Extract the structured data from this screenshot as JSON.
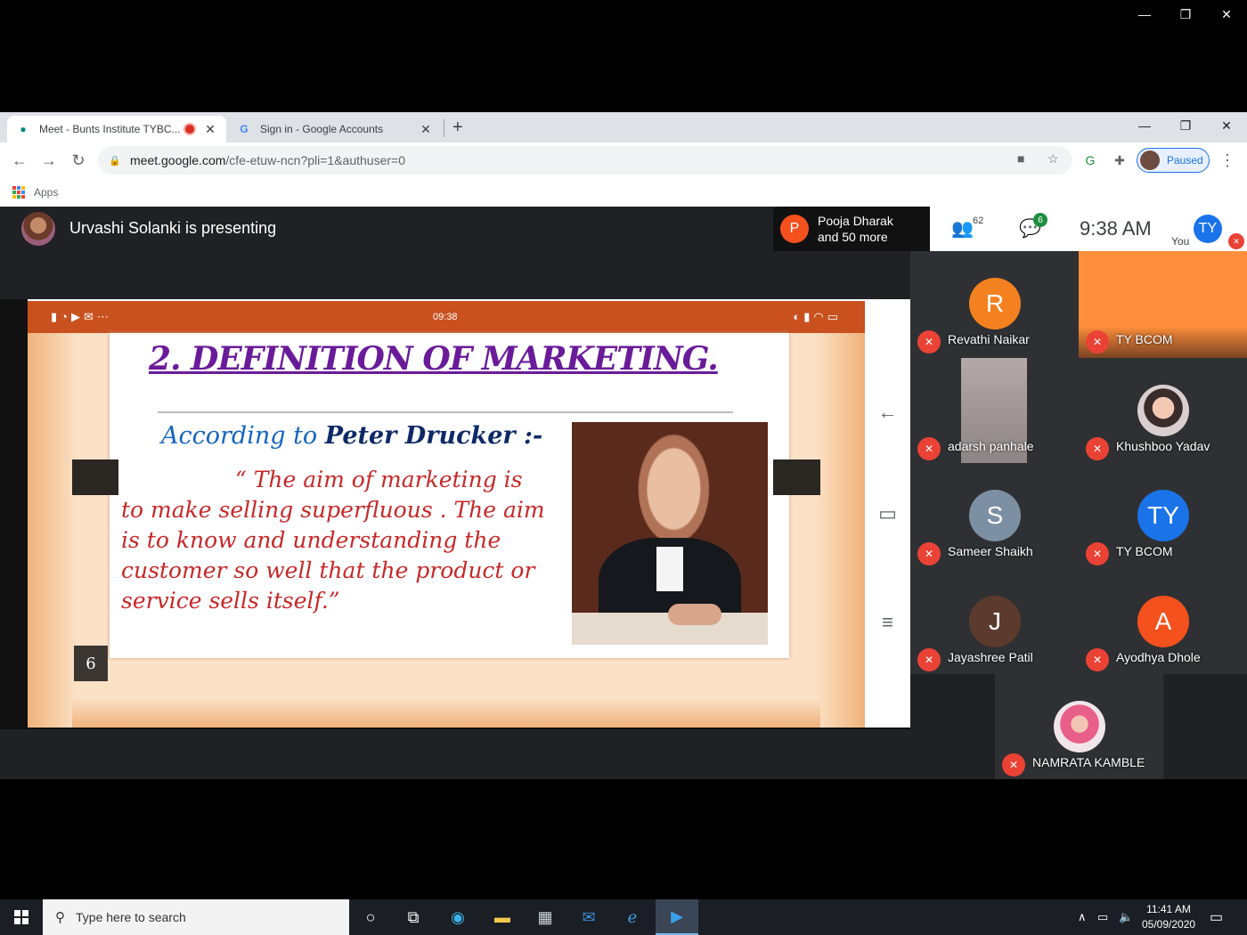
{
  "browser": {
    "tabs": [
      {
        "title": "Meet - Bunts Institute TYBC...",
        "active": true
      },
      {
        "title": "Sign in - Google Accounts",
        "active": false
      }
    ],
    "new_tab_icon": "+",
    "url_host": "meet.google.com",
    "url_path": "/cfe-etuw-ncn?pli=1&authuser=0",
    "profile_status": "Paused",
    "bookmarks": {
      "apps_label": "Apps"
    }
  },
  "meet": {
    "presenting_text": "Urvashi Solanki is presenting",
    "join_notice": {
      "initial": "P",
      "line1": "Pooja Dharak",
      "line2": "and 50 more"
    },
    "participant_count": "62",
    "chat_badge": "6",
    "time": "9:38  AM",
    "self": {
      "label": "You",
      "initials": "TY"
    },
    "participants": [
      {
        "name": "Revathi Naikar",
        "initial": "R",
        "color": "#f4811f",
        "muted": true
      },
      {
        "name": "TY BCOM",
        "initial": "",
        "color": "#ff8f3c",
        "muted": true
      },
      {
        "name": "adarsh panhale",
        "initial": "",
        "color": "",
        "muted": true
      },
      {
        "name": "Khushboo Yadav",
        "initial": "",
        "color": "",
        "muted": true
      },
      {
        "name": "Sameer Shaikh",
        "initial": "S",
        "color": "#7d8fa3",
        "muted": true
      },
      {
        "name": "TY BCOM",
        "initial": "TY",
        "color": "#1a73e8",
        "muted": true
      },
      {
        "name": "Jayashree Patil",
        "initial": "J",
        "color": "#5d3a2e",
        "muted": true
      },
      {
        "name": "Ayodhya Dhole",
        "initial": "A",
        "color": "#f4511e",
        "muted": true
      },
      {
        "name": "NAMRATA KAMBLE",
        "initial": "",
        "color": "",
        "muted": true
      }
    ]
  },
  "slide": {
    "status_time": "09:38",
    "title": "2. DEFINITION OF MARKETING.",
    "sub_prefix": "According to ",
    "sub_name": "Peter Drucker :-",
    "quote_line1": "“ The aim of marketing is",
    "quote_rest": "to make selling superfluous . The aim is to know and understanding the customer so well that the product or service sells itself.”",
    "page_number": "6"
  },
  "taskbar": {
    "search_placeholder": "Type here to search",
    "clock_time": "11:41 AM",
    "clock_date": "05/09/2020"
  }
}
